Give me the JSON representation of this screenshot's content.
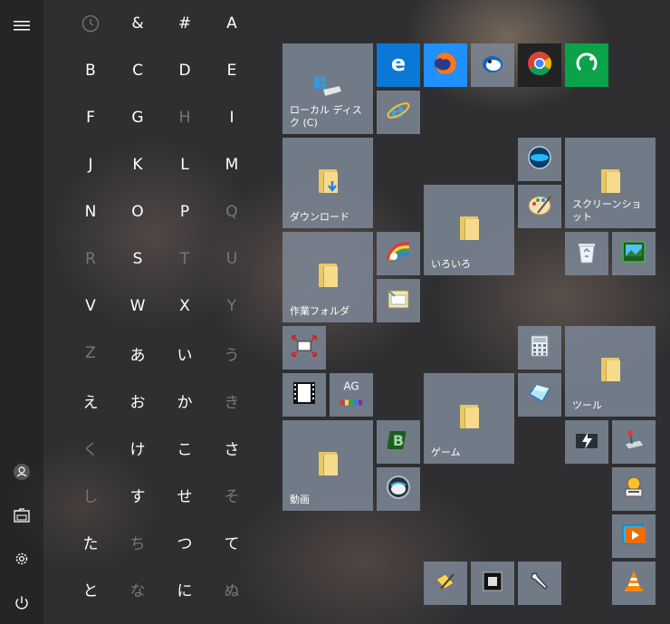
{
  "rail": {
    "menu_icon": "hamburger-icon",
    "user_icon": "user-icon",
    "documents_icon": "documents-icon",
    "settings_icon": "gear-icon",
    "power_icon": "power-icon"
  },
  "letters": {
    "row0": [
      "&",
      "#",
      "A"
    ],
    "row1": [
      "B",
      "C",
      "D",
      "E"
    ],
    "row2": [
      "F",
      "G",
      "H",
      "I"
    ],
    "row3": [
      "J",
      "K",
      "L",
      "M"
    ],
    "row4": [
      "N",
      "O",
      "P",
      "Q"
    ],
    "row5": [
      "R",
      "S",
      "T",
      "U"
    ],
    "row6": [
      "V",
      "W",
      "X",
      "Y"
    ],
    "row7": [
      "Z",
      "あ",
      "い",
      "う"
    ],
    "row8": [
      "え",
      "お",
      "か",
      "き"
    ],
    "row9": [
      "く",
      "け",
      "こ",
      "さ"
    ],
    "row10": [
      "し",
      "す",
      "せ",
      "そ"
    ],
    "row11": [
      "た",
      "ち",
      "つ",
      "て"
    ],
    "row12": [
      "と",
      "な",
      "に",
      "ぬ"
    ]
  },
  "tiles": {
    "local_disk": "ローカル ディスク (C)",
    "downloads": "ダウンロード",
    "work_folder": "作業フォルダ",
    "iroiro": "いろいろ",
    "screenshots": "スクリーンショット",
    "game": "ゲーム",
    "tools": "ツール",
    "video": "動画",
    "ag_label": "AG"
  },
  "colors": {
    "edge_tile": "#0a78d7",
    "firefox_tile": "#1e90ff",
    "chrome_tile": "#222222",
    "green_tile": "#0aa34a",
    "tile_gray": "#7d8796"
  }
}
